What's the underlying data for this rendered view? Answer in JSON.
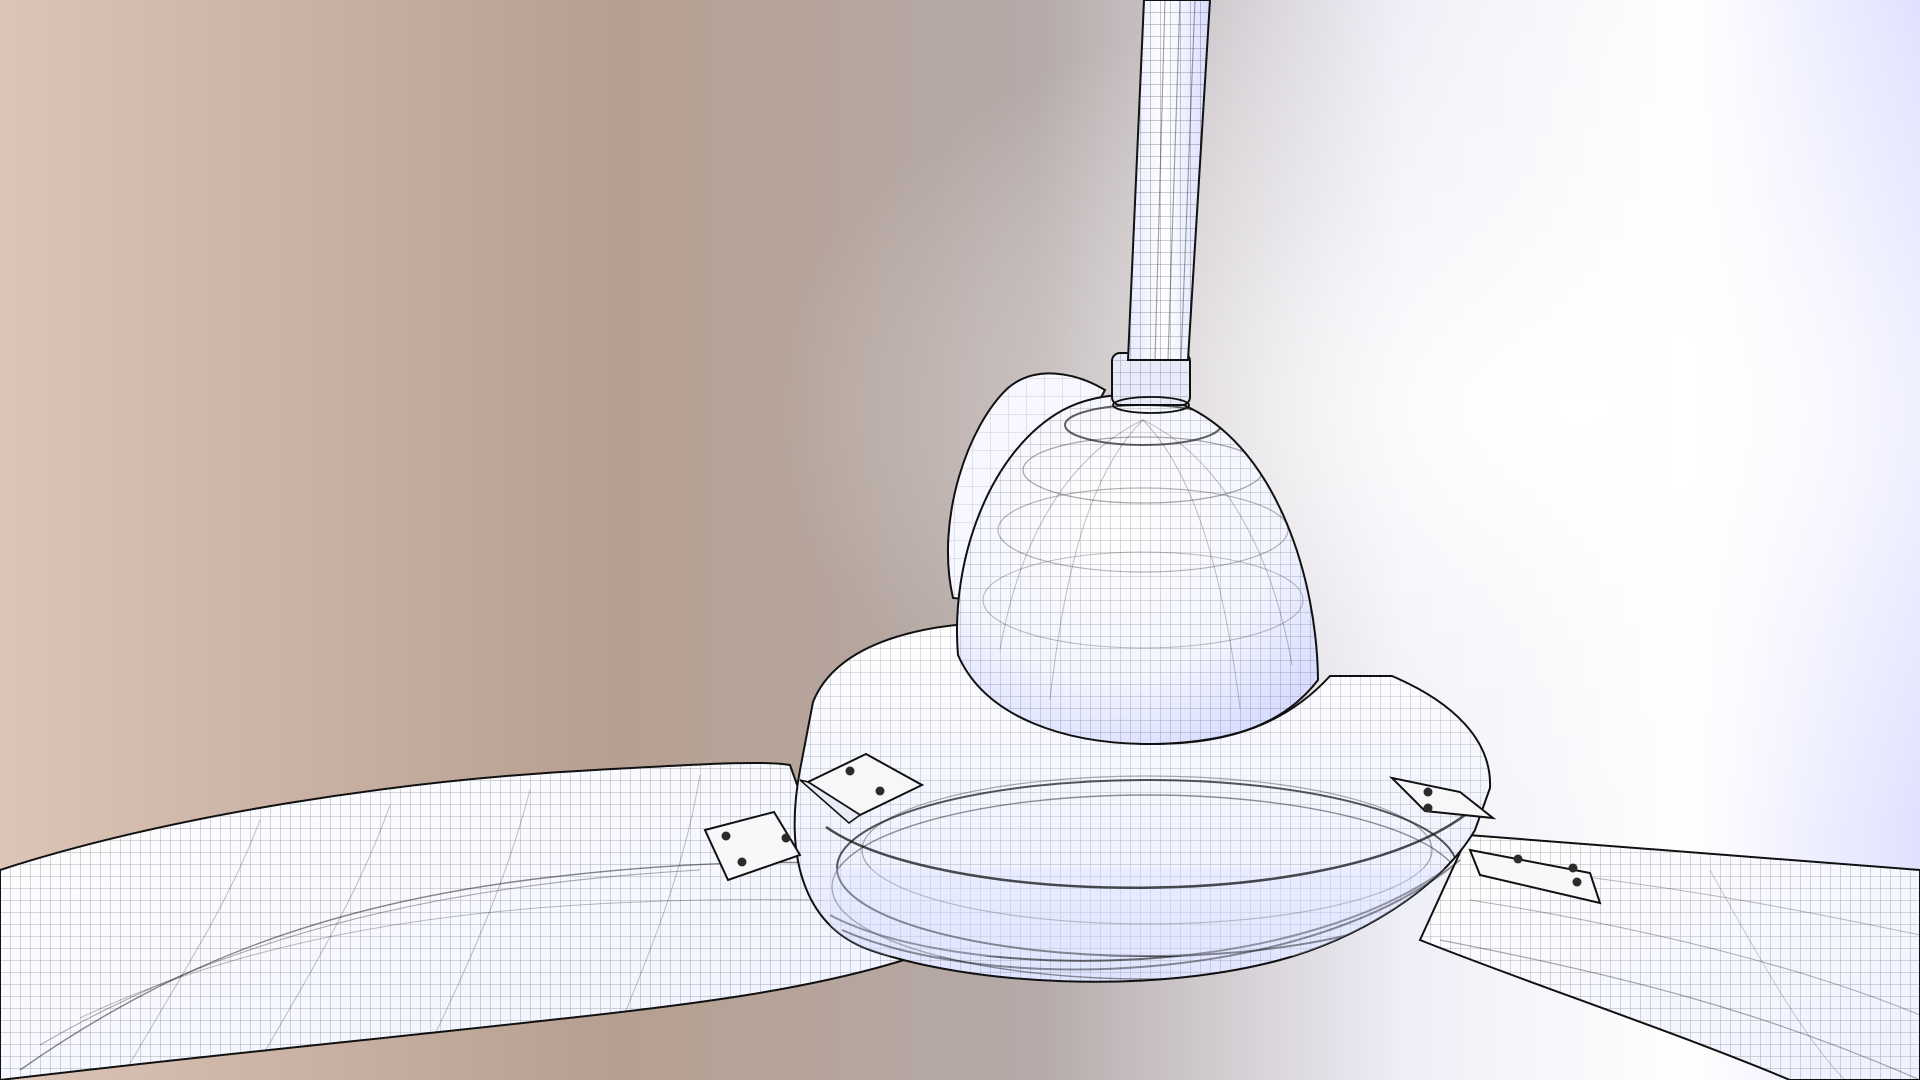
{
  "scene": {
    "subject": "ceiling-fan",
    "style": "wireframe-render",
    "background_colors": {
      "left": "#dfc6b7",
      "center": "#b9a08f",
      "right": "#ffffff",
      "right_mid": "#e4e6fb"
    },
    "mesh_colors": {
      "surface": "#fbfbff",
      "surface_shadow": "#dfe3ff",
      "line": "#202020",
      "plate": "#f4f4f7",
      "bolt": "#2b2b2b"
    },
    "icons": [
      "downrod",
      "motor-housing",
      "blade-left",
      "blade-right",
      "blade-back",
      "blade-mount-bracket"
    ]
  }
}
